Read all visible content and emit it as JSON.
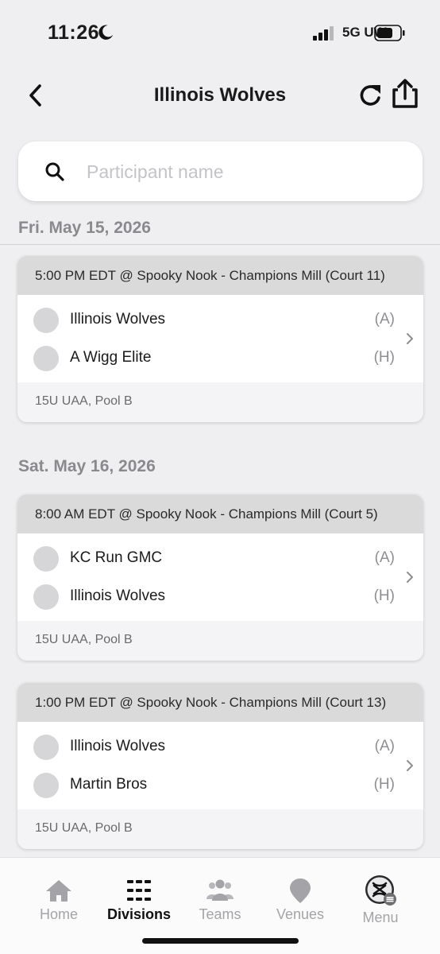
{
  "status_bar": {
    "time": "11:26",
    "network": "5G UW",
    "moon_icon": "moon-icon",
    "signal_icon": "signal-icon",
    "battery_icon": "battery-icon"
  },
  "header": {
    "title": "Illinois Wolves",
    "back_icon": "chevron-left-icon",
    "refresh_icon": "refresh-icon",
    "share_icon": "share-icon"
  },
  "search": {
    "placeholder": "Participant name",
    "value": "",
    "icon": "search-icon"
  },
  "days": [
    {
      "label": "Fri. May 15, 2026",
      "games": [
        {
          "time_venue": "5:00 PM EDT @ Spooky Nook - Champions Mill (Court 11)",
          "teams": [
            {
              "name": "Illinois Wolves",
              "side": "(A)"
            },
            {
              "name": "A Wigg Elite",
              "side": "(H)"
            }
          ],
          "division": "15U UAA, Pool B"
        }
      ]
    },
    {
      "label": "Sat. May 16, 2026",
      "games": [
        {
          "time_venue": "8:00 AM EDT @ Spooky Nook - Champions Mill (Court 5)",
          "teams": [
            {
              "name": "KC Run GMC",
              "side": "(A)"
            },
            {
              "name": "Illinois Wolves",
              "side": "(H)"
            }
          ],
          "division": "15U UAA, Pool B"
        },
        {
          "time_venue": "1:00 PM EDT @ Spooky Nook - Champions Mill (Court 13)",
          "teams": [
            {
              "name": "Illinois Wolves",
              "side": "(A)"
            },
            {
              "name": "Martin Bros",
              "side": "(H)"
            }
          ],
          "division": "15U UAA, Pool B"
        }
      ]
    }
  ],
  "tab_bar": {
    "active": "Divisions",
    "tabs": [
      {
        "label": "Home",
        "icon": "home-icon"
      },
      {
        "label": "Divisions",
        "icon": "divisions-icon"
      },
      {
        "label": "Teams",
        "icon": "teams-icon"
      },
      {
        "label": "Venues",
        "icon": "venue-pin-icon"
      },
      {
        "label": "Menu",
        "icon": "menu-logo-icon"
      }
    ]
  },
  "colors": {
    "background": "#efeff1",
    "card_header": "#dadada",
    "muted_text": "#8a8a8e",
    "active_tab": "#111111",
    "inactive_tab": "#a4a4a8"
  }
}
